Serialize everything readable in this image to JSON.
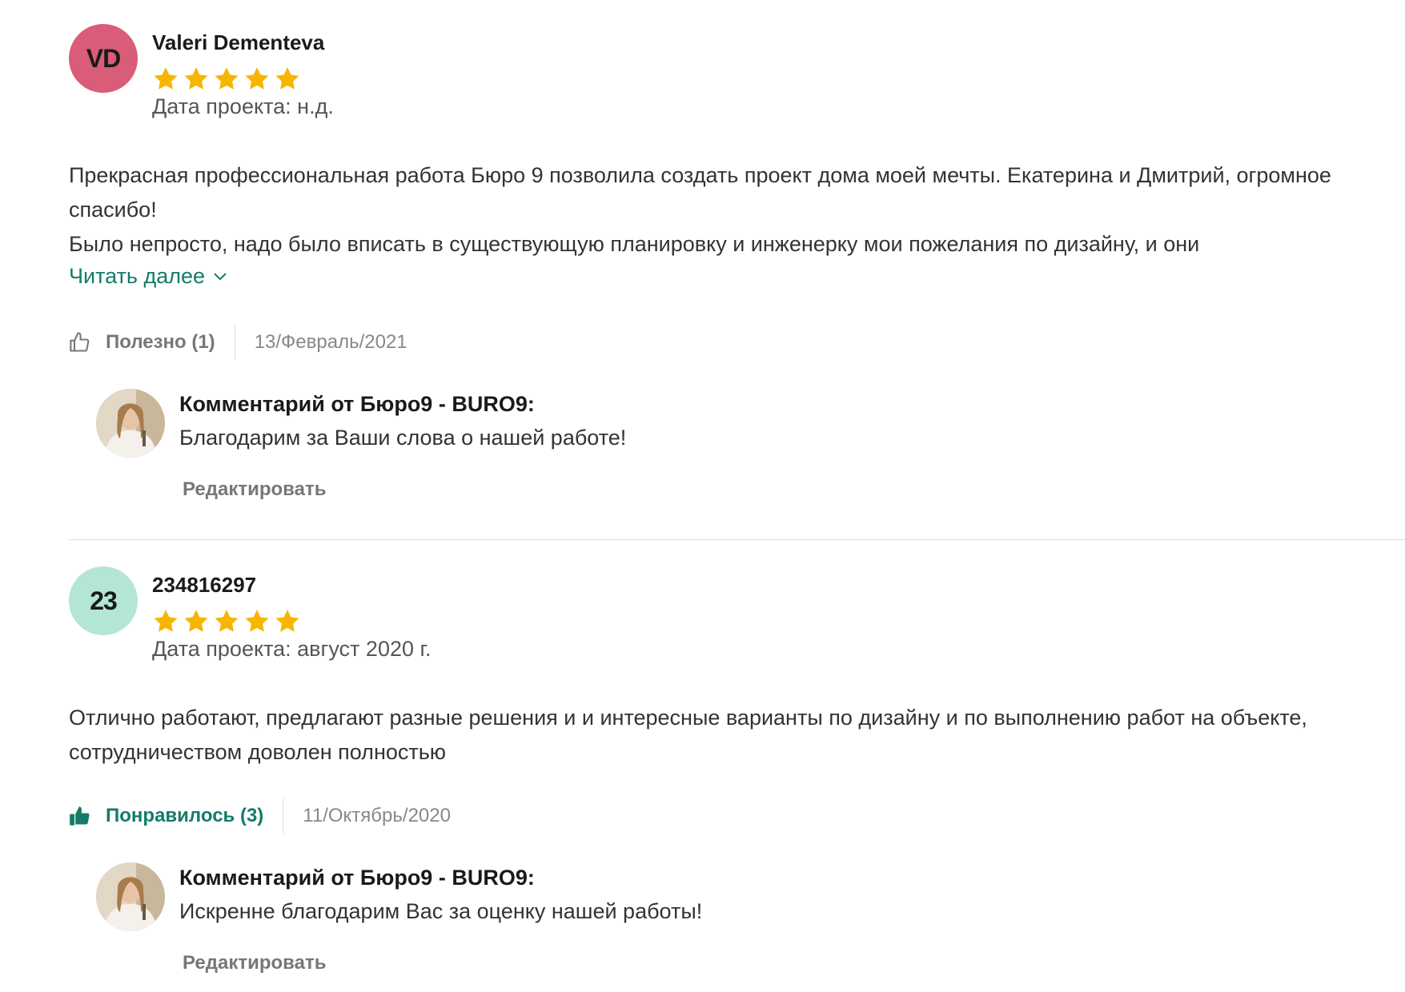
{
  "colors": {
    "accent": "#137c68",
    "star": "#f7b500",
    "avatar_vd": "#d95c78",
    "avatar_23": "#b3e6d7"
  },
  "reviews": [
    {
      "avatar_initials": "VD",
      "author": "Valeri Dementeva",
      "rating": 5,
      "project_date": "Дата проекта: н.д.",
      "text_lines": [
        "Прекрасная профессиональная работа Бюро 9 позволила создать проект дома моей мечты. Екатерина и Дмитрий, огромное спасибо!",
        "Было непросто, надо было вписать в существующую планировку и инженерку мои пожелания по дизайну, и они"
      ],
      "read_more": "Читать далее",
      "helpful_label": "Полезно (1)",
      "helpful_icon": "thumbs-up-outline-icon",
      "date": "13/Февраль/2021",
      "reply": {
        "title": "Комментарий от Бюро9 - BURO9:",
        "text": "Благодарим за Ваши слова о нашей работе!",
        "edit": "Редактировать"
      }
    },
    {
      "avatar_initials": "23",
      "author": "234816297",
      "rating": 5,
      "project_date": "Дата проекта: август 2020 г.",
      "text_lines": [
        "Отлично работают, предлагают разные решения и и интересные варианты по дизайну и по выполнению работ на объекте, сотрудничеством доволен полностью"
      ],
      "helpful_label": "Понравилось (3)",
      "helpful_icon": "thumbs-up-filled-icon",
      "date": "11/Октябрь/2020",
      "reply": {
        "title": "Комментарий от Бюро9 - BURO9:",
        "text": "Искренне благодарим Вас за оценку нашей работы!",
        "edit": "Редактировать"
      }
    }
  ]
}
